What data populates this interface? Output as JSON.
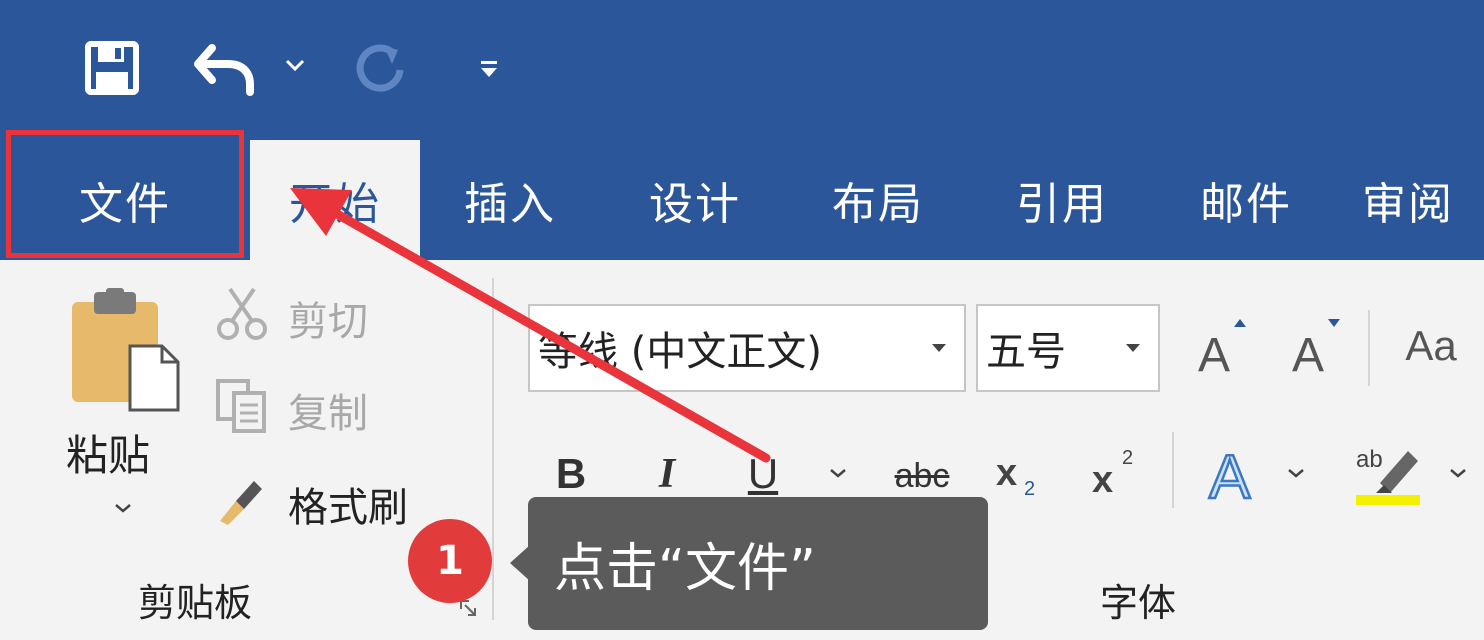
{
  "tabs": [
    {
      "label": "文件"
    },
    {
      "label": "开始"
    },
    {
      "label": "插入"
    },
    {
      "label": "设计"
    },
    {
      "label": "布局"
    },
    {
      "label": "引用"
    },
    {
      "label": "邮件"
    },
    {
      "label": "审阅"
    }
  ],
  "clipboard": {
    "paste_label": "粘贴",
    "cut_label": "剪切",
    "copy_label": "复制",
    "format_painter_label": "格式刷",
    "group_label": "剪贴板"
  },
  "font": {
    "font_name": "等线 (中文正文)",
    "font_size": "五号",
    "group_label": "字体",
    "bold": "B",
    "italic": "I",
    "underline": "U",
    "strikethrough": "abc",
    "change_case": "Aa"
  },
  "annotation": {
    "step_number": "1",
    "tooltip_text": "点击“文件”"
  },
  "colors": {
    "title_bar": "#2b579a",
    "ribbon_bg": "#f3f3f3",
    "highlight_red": "#e8343a",
    "tooltip_bg": "#5b5b5b"
  }
}
